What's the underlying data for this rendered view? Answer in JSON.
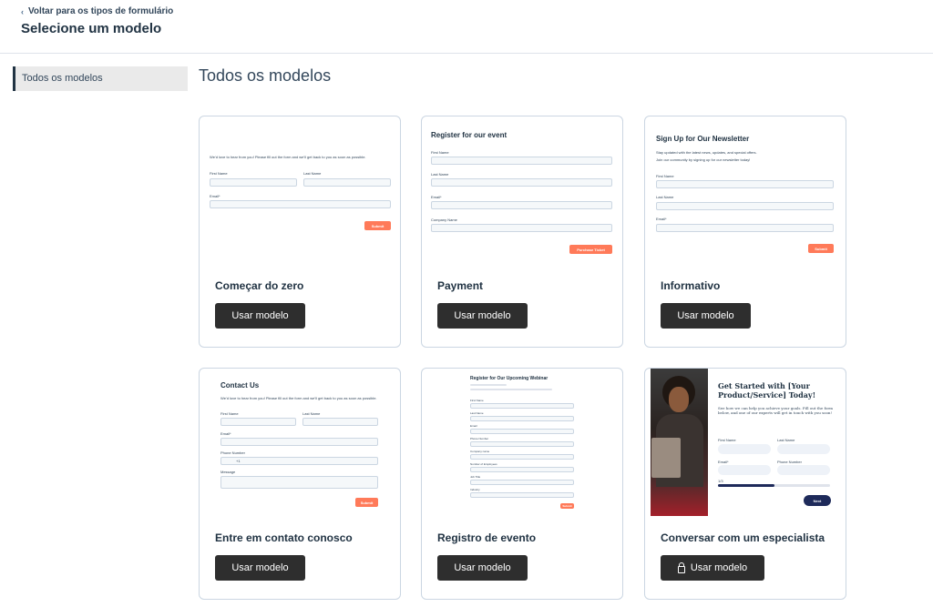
{
  "header": {
    "back_label": "Voltar para os tipos de formulário",
    "title": "Selecione um modelo"
  },
  "sidebar": {
    "items": [
      {
        "label": "Todos os modelos",
        "active": true
      }
    ]
  },
  "main": {
    "title": "Todos os modelos",
    "use_label": "Usar modelo"
  },
  "cards": [
    {
      "name": "Começar do zero",
      "preview": {
        "intro": "We'd love to hear from you! Please fill out the form and we'll get back to you as soon as possible.",
        "first_name": "First Name",
        "last_name": "Last Name",
        "email": "Email*",
        "submit": "Submit"
      }
    },
    {
      "name": "Payment",
      "preview": {
        "title": "Register for our event",
        "first_name": "First Name",
        "last_name": "Last Name",
        "email": "Email*",
        "company": "Company Name",
        "submit": "Purchase Ticket"
      }
    },
    {
      "name": "Informativo",
      "preview": {
        "title": "Sign Up for Our Newsletter",
        "intro1": "Stay updated with the latest news, updates, and special offers.",
        "intro2": "Join our community by signing up for our newsletter today!",
        "first_name": "First Name",
        "last_name": "Last Name",
        "email": "Email*",
        "submit": "Submit"
      }
    },
    {
      "name": "Entre em contato conosco",
      "preview": {
        "title": "Contact Us",
        "intro": "We'd love to hear from you! Please fill out the form and we'll get back to you as soon as possible.",
        "first_name": "First Name",
        "last_name": "Last Name",
        "email": "Email*",
        "phone": "Phone Number",
        "phone_prefix": "+1",
        "message": "Message",
        "submit": "Submit"
      }
    },
    {
      "name": "Registro de evento",
      "preview": {
        "title": "Register for Our Upcoming Webinar",
        "first_name": "First Name",
        "last_name": "Last Name",
        "email": "Email",
        "phone": "Phone Number",
        "company": "Company name",
        "employees": "Number of Employees",
        "job": "Job Title",
        "industry": "Industry",
        "submit": "Submit"
      }
    },
    {
      "name": "Conversar com um especialista",
      "preview": {
        "title": "Get Started with [Your Product/Service] Today!",
        "intro": "See how we can help you achieve your goals. Fill out the form below, and one of our experts will get in touch with you soon!",
        "first_name": "First Name",
        "last_name": "Last Name",
        "email": "Email*",
        "phone": "Phone Number",
        "progress_label": "1/3",
        "progress": 0.5,
        "next": "Next"
      }
    }
  ],
  "colors": {
    "accent": "#ff7a59",
    "dark_button": "#2e2e2e",
    "navy": "#1e2a5a"
  }
}
